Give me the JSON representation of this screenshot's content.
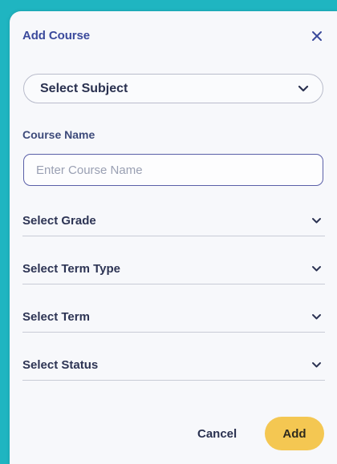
{
  "modal": {
    "title": "Add Course",
    "close_icon": "close-icon"
  },
  "subject": {
    "label": "Select Subject",
    "icon": "chevron-down-icon"
  },
  "course_name": {
    "label": "Course Name",
    "value": "",
    "placeholder": "Enter Course Name"
  },
  "dropdowns": {
    "grade": "Select Grade",
    "term_type": "Select Term Type",
    "term": "Select Term",
    "status": "Select Status"
  },
  "actions": {
    "cancel": "Cancel",
    "add": "Add"
  },
  "colors": {
    "background": "#1fb5c1",
    "modal": "#f7f8fb",
    "title": "#3b4a9c",
    "add_button": "#f4c752",
    "input_border": "#5a5fa8"
  }
}
